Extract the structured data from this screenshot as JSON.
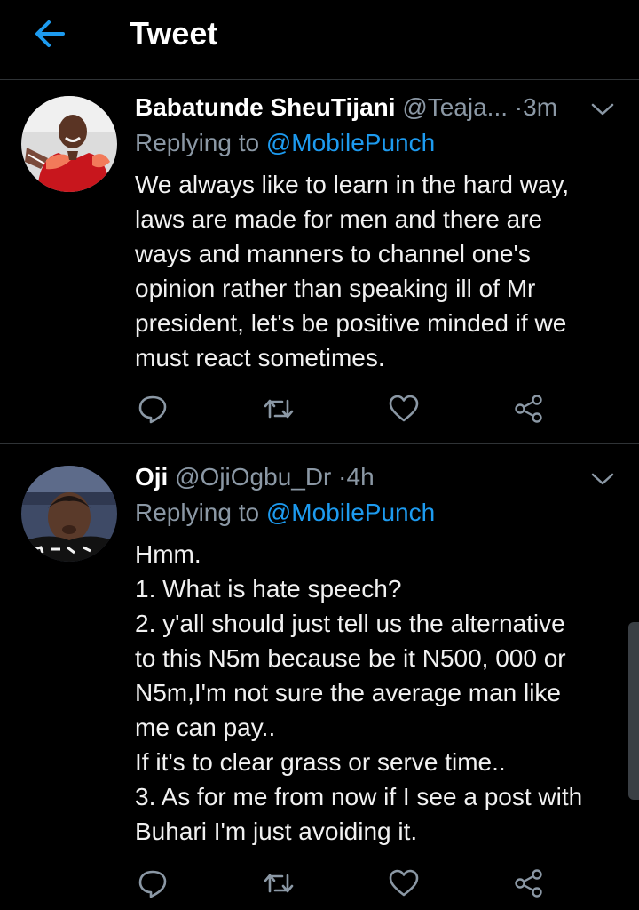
{
  "header": {
    "title": "Tweet",
    "back_icon": "arrow-left-icon",
    "accent_color": "#1d9bf0"
  },
  "tweets": [
    {
      "author_name": "Babatunde SheuTijani",
      "handle": "@Teaja...",
      "separator": "·",
      "time": "3m",
      "replying_prefix": "Replying to",
      "replying_to": "@MobilePunch",
      "lines": [
        "We always like to learn in the hard way,",
        "laws are made for men and there are",
        "ways and manners to channel one's",
        "opinion rather than speaking ill of Mr",
        "president, let's be positive minded if we",
        "must react sometimes."
      ]
    },
    {
      "author_name": "Oji",
      "handle": "@OjiOgbu_Dr",
      "separator": "·",
      "time": "4h",
      "replying_prefix": "Replying to",
      "replying_to": "@MobilePunch",
      "lines": [
        "Hmm.",
        "1. What is hate speech?",
        "2. y'all should just tell us the alternative",
        "to this N5m because be it N500, 000 or",
        "N5m,I'm not sure the average man like",
        "me can pay..",
        "If it's to clear grass or serve time..",
        "3. As for me from now if I see a post with",
        "Buhari I'm just avoiding it."
      ]
    }
  ],
  "icons": {
    "reply": "reply-bubble-icon",
    "retweet": "retweet-icon",
    "like": "heart-icon",
    "share": "share-icon",
    "caret": "chevron-down-icon"
  }
}
